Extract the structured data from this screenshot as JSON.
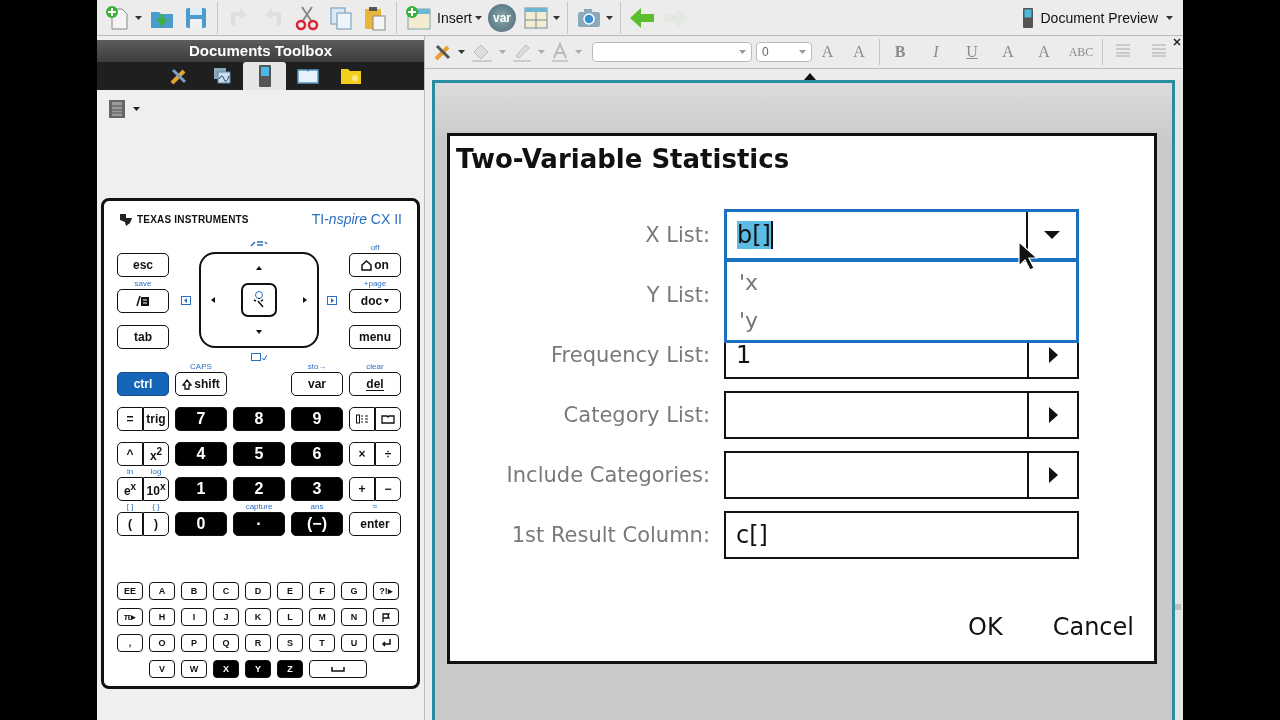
{
  "toolbar": {
    "buttons": [
      {
        "kind": "new",
        "menu": true,
        "disabled": false
      },
      {
        "kind": "open",
        "menu": false,
        "disabled": false
      },
      {
        "kind": "save",
        "menu": false,
        "disabled": false
      },
      {
        "kind": "sep"
      },
      {
        "kind": "undo",
        "menu": false,
        "disabled": true
      },
      {
        "kind": "redo",
        "menu": false,
        "disabled": true
      },
      {
        "kind": "cut",
        "menu": false,
        "disabled": false
      },
      {
        "kind": "copy",
        "menu": false,
        "disabled": false
      },
      {
        "kind": "paste",
        "menu": false,
        "disabled": false
      },
      {
        "kind": "sep"
      },
      {
        "kind": "insert",
        "label": "Insert",
        "menu": true,
        "disabled": false
      },
      {
        "kind": "var",
        "label": "var",
        "menu": false,
        "disabled": false
      },
      {
        "kind": "layout",
        "menu": true,
        "disabled": false
      },
      {
        "kind": "sep"
      },
      {
        "kind": "camera",
        "menu": true,
        "disabled": false
      },
      {
        "kind": "sep"
      },
      {
        "kind": "back",
        "menu": false,
        "disabled": false
      },
      {
        "kind": "forward",
        "menu": false,
        "disabled": true
      }
    ],
    "preview": {
      "label": "Document Preview"
    }
  },
  "toolbox": {
    "title": "Documents Toolbox",
    "tabs": [
      {
        "kind": "tools",
        "selected": false
      },
      {
        "kind": "pages",
        "selected": false
      },
      {
        "kind": "handheld",
        "selected": true
      },
      {
        "kind": "book",
        "selected": false
      },
      {
        "kind": "folder",
        "selected": false
      }
    ],
    "keypad": {
      "brand": "TEXAS INSTRUMENTS",
      "model": "TI-*nspire* CX II",
      "left_keys": [
        {
          "kind": "light",
          "label": "esc"
        },
        {
          "kind": "scratchpad",
          "above": "save"
        },
        {
          "kind": "light",
          "label": "tab"
        }
      ],
      "right_keys": [
        {
          "kind": "home",
          "label": "on",
          "above": "off"
        },
        {
          "kind": "docmenu",
          "label": "doc",
          "above": "+page"
        },
        {
          "kind": "light",
          "label": "menu"
        }
      ],
      "main_rows": [
        [
          {
            "kind": "blue",
            "label": "ctrl"
          },
          {
            "kind": "shift",
            "label": "shift",
            "above": "CAPS"
          },
          {
            "kind": "blank"
          },
          {
            "kind": "light",
            "label": "var",
            "above": "sto→"
          },
          {
            "kind": "del",
            "label": "del",
            "above": "clear"
          }
        ],
        [
          {
            "kind": "pair",
            "halves": [
              {
                "kind": "light",
                "label": "="
              },
              {
                "kind": "light",
                "label": "trig"
              }
            ]
          },
          {
            "kind": "dark",
            "label": "7"
          },
          {
            "kind": "dark",
            "label": "8"
          },
          {
            "kind": "dark",
            "label": "9"
          },
          {
            "kind": "pair",
            "halves": [
              {
                "kind": "template"
              },
              {
                "kind": "catalog"
              }
            ]
          }
        ],
        [
          {
            "kind": "pair",
            "halves": [
              {
                "kind": "light",
                "label": "^"
              },
              {
                "kind": "light",
                "label": "x$^{2}$"
              }
            ]
          },
          {
            "kind": "dark",
            "label": "4"
          },
          {
            "kind": "dark",
            "label": "5"
          },
          {
            "kind": "dark",
            "label": "6"
          },
          {
            "kind": "pair",
            "halves": [
              {
                "kind": "light",
                "label": "×"
              },
              {
                "kind": "light",
                "label": "÷"
              }
            ]
          }
        ],
        [
          {
            "kind": "pair",
            "halves": [
              {
                "kind": "light",
                "label": "e$^{x}$",
                "above": "ln"
              },
              {
                "kind": "light",
                "label": "10$^{x}$",
                "above": "log"
              }
            ]
          },
          {
            "kind": "dark",
            "label": "1"
          },
          {
            "kind": "dark",
            "label": "2"
          },
          {
            "kind": "dark",
            "label": "3"
          },
          {
            "kind": "pair",
            "halves": [
              {
                "kind": "light",
                "label": "+"
              },
              {
                "kind": "light",
                "label": "−"
              }
            ]
          }
        ],
        [
          {
            "kind": "pair",
            "halves": [
              {
                "kind": "light",
                "label": "(",
                "above": "[ ]"
              },
              {
                "kind": "light",
                "label": ")",
                "above": "{ }"
              }
            ]
          },
          {
            "kind": "dark",
            "label": "0"
          },
          {
            "kind": "dark",
            "label": "·",
            "above": "capture"
          },
          {
            "kind": "dark",
            "label": "(−)",
            "above": "ans"
          },
          {
            "kind": "light",
            "label": "enter",
            "above": "≈"
          }
        ]
      ],
      "alpha_rows": [
        [
          {
            "kind": "light",
            "label": "EE"
          },
          {
            "kind": "light",
            "label": "A"
          },
          {
            "kind": "light",
            "label": "B"
          },
          {
            "kind": "light",
            "label": "C"
          },
          {
            "kind": "light",
            "label": "D"
          },
          {
            "kind": "light",
            "label": "E"
          },
          {
            "kind": "light",
            "label": "F"
          },
          {
            "kind": "light",
            "label": "G"
          },
          {
            "kind": "light",
            "label": "?!▸"
          }
        ],
        [
          {
            "kind": "light",
            "label": "π▸"
          },
          {
            "kind": "light",
            "label": "H"
          },
          {
            "kind": "light",
            "label": "I"
          },
          {
            "kind": "light",
            "label": "J"
          },
          {
            "kind": "light",
            "label": "K"
          },
          {
            "kind": "light",
            "label": "L"
          },
          {
            "kind": "light",
            "label": "M"
          },
          {
            "kind": "light",
            "label": "N"
          },
          {
            "kind": "flag"
          }
        ],
        [
          {
            "kind": "light",
            "label": ","
          },
          {
            "kind": "light",
            "label": "O"
          },
          {
            "kind": "light",
            "label": "P"
          },
          {
            "kind": "light",
            "label": "Q"
          },
          {
            "kind": "light",
            "label": "R"
          },
          {
            "kind": "light",
            "label": "S"
          },
          {
            "kind": "light",
            "label": "T"
          },
          {
            "kind": "light",
            "label": "U"
          },
          {
            "kind": "return"
          }
        ],
        [
          {
            "kind": "blank"
          },
          {
            "kind": "light",
            "label": "V"
          },
          {
            "kind": "light",
            "label": "W"
          },
          {
            "kind": "dark",
            "label": "X"
          },
          {
            "kind": "dark",
            "label": "Y"
          },
          {
            "kind": "dark",
            "label": "Z"
          },
          {
            "kind": "space"
          }
        ]
      ]
    }
  },
  "format_bar": {
    "size_value": "0",
    "buttons": [
      {
        "kind": "grow",
        "label": "A",
        "disabled": true
      },
      {
        "kind": "shrink",
        "label": "A",
        "disabled": true
      },
      {
        "kind": "sep"
      },
      {
        "kind": "bold",
        "label": "B",
        "disabled": true
      },
      {
        "kind": "italic",
        "label": "I",
        "disabled": true
      },
      {
        "kind": "underline",
        "label": "U",
        "disabled": true
      },
      {
        "kind": "sup",
        "label": "A",
        "disabled": true
      },
      {
        "kind": "sub",
        "label": "A",
        "disabled": true
      },
      {
        "kind": "strike",
        "label": "ABC",
        "disabled": true
      },
      {
        "kind": "sep"
      },
      {
        "kind": "align",
        "disabled": true
      },
      {
        "kind": "align",
        "disabled": true
      }
    ]
  },
  "dialog": {
    "title": "Two-Variable Statistics",
    "fields": [
      {
        "label": "X List:",
        "kind": "picker",
        "value": "b[]",
        "focused": true,
        "options": [
          "'x",
          "'y"
        ]
      },
      {
        "label": "Y List:",
        "kind": "covered"
      },
      {
        "label": "Frequency List:",
        "kind": "picker",
        "value": "1",
        "focused": false
      },
      {
        "label": "Category List:",
        "kind": "picker",
        "focused": false
      },
      {
        "label": "Include Categories:",
        "kind": "picker",
        "focused": false
      },
      {
        "label": "1st Result Column:",
        "kind": "text",
        "value": "c[]",
        "focused": false
      }
    ],
    "buttons": [
      "OK",
      "Cancel"
    ]
  }
}
